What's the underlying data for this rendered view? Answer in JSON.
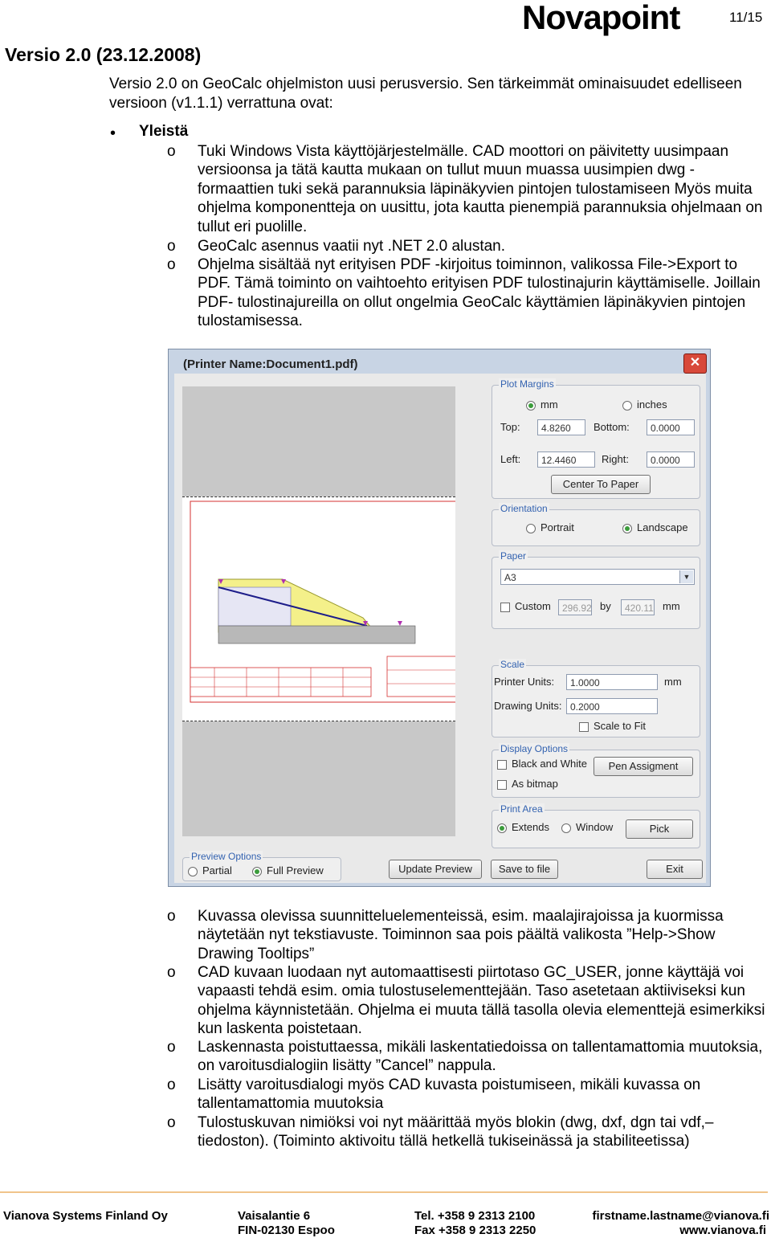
{
  "header": {
    "logo": "Novapoint",
    "page": "11/15"
  },
  "heading": "Versio 2.0 (23.12.2008)",
  "intro": "Versio 2.0 on GeoCalc ohjelmiston uusi perusversio. Sen tärkeimmät ominaisuudet edelliseen versioon (v1.1.1) verrattuna ovat:",
  "section_title": "Yleistä",
  "bullet_marker": "o",
  "items_top": [
    "Tuki Windows Vista käyttöjärjestelmälle. CAD moottori on päivitetty uusimpaan versioonsa ja tätä kautta mukaan on tullut muun muassa uusimpien dwg -formaattien tuki sekä parannuksia läpinäkyvien pintojen tulostamiseen Myös muita ohjelma komponentteja on uusittu, jota kautta pienempiä parannuksia ohjelmaan on tullut eri puolille.",
    "GeoCalc asennus vaatii nyt .NET 2.0 alustan.",
    "Ohjelma sisältää nyt erityisen PDF -kirjoitus toiminnon, valikossa File->Export to PDF. Tämä toiminto on vaihtoehto erityisen PDF tulostinajurin käyttämiselle. Joillain PDF- tulostinajureilla on ollut ongelmia GeoCalc käyttämien läpinäkyvien pintojen tulostamisessa."
  ],
  "dialog": {
    "title": "(Printer Name:Document1.pdf)",
    "close": "✕",
    "plot_margins": {
      "title": "Plot Margins",
      "mm": "mm",
      "inches": "inches",
      "top_label": "Top:",
      "top": "4.8260",
      "bottom_label": "Bottom:",
      "bottom": "0.0000",
      "left_label": "Left:",
      "left": "12.4460",
      "right_label": "Right:",
      "right": "0.0000",
      "center_button": "Center To Paper"
    },
    "orientation": {
      "title": "Orientation",
      "portrait": "Portrait",
      "landscape": "Landscape"
    },
    "paper": {
      "title": "Paper",
      "selected": "A3",
      "custom": "Custom",
      "width": "296.92",
      "by": "by",
      "height": "420.11",
      "unit": "mm"
    },
    "scale": {
      "title": "Scale",
      "printer_units_label": "Printer Units:",
      "printer_units": "1.0000",
      "unit": "mm",
      "drawing_units_label": "Drawing Units:",
      "drawing_units": "0.2000",
      "scale_to_fit": "Scale to Fit"
    },
    "display_options": {
      "title": "Display Options",
      "black_white": "Black and White",
      "as_bitmap": "As bitmap",
      "pen_button": "Pen Assigment"
    },
    "print_area": {
      "title": "Print Area",
      "extends": "Extends",
      "window": "Window",
      "pick_button": "Pick"
    },
    "preview_options": {
      "title": "Preview Options",
      "partial": "Partial",
      "full": "Full Preview"
    },
    "buttons": {
      "update": "Update Preview",
      "save": "Save to file",
      "exit": "Exit"
    }
  },
  "items_bottom": [
    "Kuvassa olevissa suunnitteluelementeissä, esim. maalajirajoissa ja kuormissa näytetään nyt tekstiavuste. Toiminnon saa pois päältä valikosta ”Help->Show Drawing Tooltips”",
    "CAD kuvaan luodaan nyt automaattisesti piirtotaso GC_USER, jonne käyttäjä voi vapaasti tehdä esim. omia tulostuselementtejään. Taso asetetaan aktiiviseksi kun ohjelma käynnistetään. Ohjelma ei muuta tällä tasolla olevia elementtejä esimerkiksi kun laskenta poistetaan.",
    "Laskennasta poistuttaessa, mikäli laskentatiedoissa on tallentamattomia muutoksia, on varoitusdialogiin lisätty ”Cancel” nappula.",
    "Lisätty varoitusdialogi myös CAD kuvasta poistumiseen, mikäli kuvassa on tallentamattomia muutoksia",
    "Tulostuskuvan nimiöksi voi nyt määrittää myös blokin (dwg, dxf, dgn tai vdf,– tiedoston). (Toiminto aktivoitu tällä hetkellä tukiseinässä ja stabiliteetissa)"
  ],
  "footer": {
    "company": "Vianova Systems Finland Oy",
    "street": "Vaisalantie 6",
    "city": "FIN-02130 Espoo",
    "tel": "Tel. +358 9 2313 2100",
    "fax": "Fax +358 9 2313 2250",
    "email": "firstname.lastname@vianova.fi",
    "web": "www.vianova.fi"
  }
}
